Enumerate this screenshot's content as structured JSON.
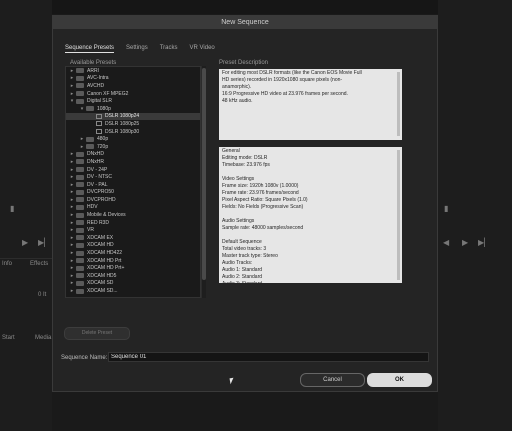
{
  "dialog": {
    "title": "New Sequence",
    "tabs": [
      {
        "label": "Sequence Presets",
        "active": true
      },
      {
        "label": "Settings",
        "active": false
      },
      {
        "label": "Tracks",
        "active": false
      },
      {
        "label": "VR Video",
        "active": false
      }
    ],
    "available_presets_label": "Available Presets",
    "preset_description_label": "Preset Description",
    "delete_preset_label": "Delete Preset",
    "sequence_name_label": "Sequence Name:",
    "sequence_name_value": "Sequence 01",
    "cancel_label": "Cancel",
    "ok_label": "OK"
  },
  "preset_tree": [
    {
      "label": "ARRI",
      "level": 0,
      "type": "folder",
      "expanded": false
    },
    {
      "label": "AVC-Intra",
      "level": 0,
      "type": "folder",
      "expanded": false
    },
    {
      "label": "AVCHD",
      "level": 0,
      "type": "folder",
      "expanded": false
    },
    {
      "label": "Canon XF MPEG2",
      "level": 0,
      "type": "folder",
      "expanded": false
    },
    {
      "label": "Digital SLR",
      "level": 0,
      "type": "folder",
      "expanded": true
    },
    {
      "label": "1080p",
      "level": 1,
      "type": "folder",
      "expanded": true
    },
    {
      "label": "DSLR 1080p24",
      "level": 2,
      "type": "preset",
      "selected": true
    },
    {
      "label": "DSLR 1080p25",
      "level": 2,
      "type": "preset"
    },
    {
      "label": "DSLR 1080p30",
      "level": 2,
      "type": "preset"
    },
    {
      "label": "480p",
      "level": 1,
      "type": "folder",
      "expanded": false
    },
    {
      "label": "720p",
      "level": 1,
      "type": "folder",
      "expanded": false
    },
    {
      "label": "DNxHD",
      "level": 0,
      "type": "folder",
      "expanded": false
    },
    {
      "label": "DNxHR",
      "level": 0,
      "type": "folder",
      "expanded": false
    },
    {
      "label": "DV - 24P",
      "level": 0,
      "type": "folder",
      "expanded": false
    },
    {
      "label": "DV - NTSC",
      "level": 0,
      "type": "folder",
      "expanded": false
    },
    {
      "label": "DV - PAL",
      "level": 0,
      "type": "folder",
      "expanded": false
    },
    {
      "label": "DVCPRO50",
      "level": 0,
      "type": "folder",
      "expanded": false
    },
    {
      "label": "DVCPROHD",
      "level": 0,
      "type": "folder",
      "expanded": false
    },
    {
      "label": "HDV",
      "level": 0,
      "type": "folder",
      "expanded": false
    },
    {
      "label": "Mobile & Devices",
      "level": 0,
      "type": "folder",
      "expanded": false
    },
    {
      "label": "RED R3D",
      "level": 0,
      "type": "folder",
      "expanded": false
    },
    {
      "label": "VR",
      "level": 0,
      "type": "folder",
      "expanded": false
    },
    {
      "label": "XDCAM EX",
      "level": 0,
      "type": "folder",
      "expanded": false
    },
    {
      "label": "XDCAM HD",
      "level": 0,
      "type": "folder",
      "expanded": false
    },
    {
      "label": "XDCAM HD422",
      "level": 0,
      "type": "folder",
      "expanded": false
    },
    {
      "label": "XDCAM HD Prt",
      "level": 0,
      "type": "folder",
      "expanded": false
    },
    {
      "label": "XDCAM HD Prt+",
      "level": 0,
      "type": "folder",
      "expanded": false
    },
    {
      "label": "XDCAM HD5",
      "level": 0,
      "type": "folder",
      "expanded": false
    },
    {
      "label": "XDCAM SD",
      "level": 0,
      "type": "folder",
      "expanded": false
    },
    {
      "label": "XDCAM SD...",
      "level": 0,
      "type": "folder",
      "expanded": false
    }
  ],
  "description": {
    "lines": [
      "For editing most DSLR formats (like the Canon EOS Movie Full",
      "HD series) recorded in 1920x1080 square pixels (non-",
      "anamorphic).",
      "16:9 Progressive HD video at 23.976 frames per second.",
      "48 kHz audio."
    ]
  },
  "general_info": {
    "text": "General\nEditing mode: DSLR\nTimebase: 23.976 fps\n\nVideo Settings\nFrame size: 1920h 1080v (1.0000)\nFrame rate: 23.976  frames/second\nPixel Aspect Ratio: Square Pixels (1.0)\nFields: No Fields (Progressive Scan)\n\nAudio Settings\nSample rate: 48000 samples/second\n\nDefault Sequence\nTotal video tracks: 3\nMaster track type: Stereo\nAudio Tracks:\nAudio 1: Standard\nAudio 2: Standard\nAudio 3: Standard"
  },
  "background": {
    "info_label": "Info",
    "effects_label": "Effects",
    "start_label": "Start",
    "media_label": "Media",
    "zero_label": "0 It"
  }
}
